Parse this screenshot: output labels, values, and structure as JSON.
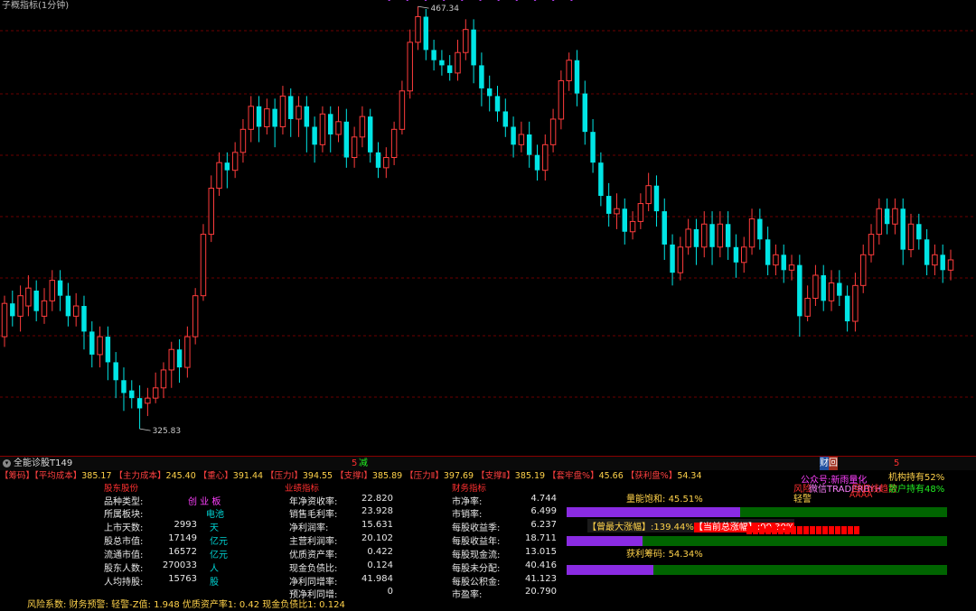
{
  "chart_data": {
    "type": "candlestick",
    "title": "子概指标(1分钟)",
    "ylim": [
      300,
      480
    ],
    "annotations": {
      "high": "467.34",
      "low": "325.83"
    },
    "gridlines": [
      475,
      445,
      415,
      385,
      355,
      325,
      300
    ],
    "colors": {
      "up": "#ff3c3c",
      "down": "#00e5e5",
      "grid": "#6b0000"
    },
    "candles": [
      [
        1,
        362,
        375,
        358,
        378
      ],
      [
        2,
        375,
        370,
        366,
        380
      ],
      [
        3,
        370,
        378,
        364,
        382
      ],
      [
        4,
        374,
        381,
        370,
        386
      ],
      [
        5,
        380,
        372,
        368,
        384
      ],
      [
        6,
        370,
        376,
        367,
        381
      ],
      [
        7,
        376,
        384,
        372,
        388
      ],
      [
        8,
        384,
        378,
        372,
        388
      ],
      [
        9,
        378,
        370,
        366,
        383
      ],
      [
        10,
        370,
        374,
        366,
        379
      ],
      [
        11,
        374,
        364,
        357,
        378
      ],
      [
        12,
        364,
        355,
        350,
        368
      ],
      [
        13,
        355,
        362,
        350,
        366
      ],
      [
        14,
        362,
        352,
        345,
        366
      ],
      [
        15,
        352,
        345,
        338,
        356
      ],
      [
        16,
        345,
        340,
        333,
        350
      ],
      [
        17,
        341,
        338,
        334,
        345
      ],
      [
        18,
        338,
        334,
        326,
        343
      ],
      [
        19,
        336,
        338,
        331,
        342
      ],
      [
        20,
        338,
        342,
        336,
        348
      ],
      [
        21,
        342,
        349,
        338,
        352
      ],
      [
        22,
        349,
        357,
        342,
        360
      ],
      [
        23,
        357,
        350,
        344,
        361
      ],
      [
        24,
        350,
        362,
        346,
        366
      ],
      [
        25,
        362,
        378,
        359,
        381
      ],
      [
        26,
        378,
        402,
        376,
        406
      ],
      [
        27,
        402,
        420,
        399,
        425
      ],
      [
        28,
        420,
        430,
        417,
        434
      ],
      [
        29,
        430,
        427,
        420,
        434
      ],
      [
        30,
        427,
        434,
        424,
        438
      ],
      [
        31,
        434,
        443,
        430,
        447
      ],
      [
        32,
        443,
        452,
        438,
        456
      ],
      [
        33,
        452,
        444,
        438,
        456
      ],
      [
        34,
        444,
        451,
        441,
        455
      ],
      [
        35,
        451,
        444,
        436,
        455
      ],
      [
        36,
        444,
        456,
        441,
        460
      ],
      [
        37,
        456,
        447,
        440,
        459
      ],
      [
        38,
        447,
        452,
        440,
        456
      ],
      [
        39,
        452,
        444,
        434,
        456
      ],
      [
        40,
        444,
        437,
        430,
        448
      ],
      [
        41,
        437,
        449,
        434,
        452
      ],
      [
        42,
        449,
        441,
        434,
        452
      ],
      [
        43,
        441,
        446,
        438,
        452
      ],
      [
        44,
        446,
        432,
        428,
        451
      ],
      [
        45,
        432,
        440,
        428,
        444
      ],
      [
        46,
        440,
        448,
        436,
        452
      ],
      [
        47,
        448,
        434,
        430,
        451
      ],
      [
        48,
        434,
        428,
        424,
        438
      ],
      [
        49,
        428,
        432,
        424,
        436
      ],
      [
        50,
        432,
        443,
        429,
        446
      ],
      [
        51,
        443,
        458,
        441,
        462
      ],
      [
        52,
        458,
        477,
        455,
        482
      ],
      [
        53,
        477,
        487,
        474,
        491
      ],
      [
        54,
        487,
        474,
        470,
        490
      ],
      [
        55,
        474,
        470,
        466,
        478
      ],
      [
        56,
        470,
        468,
        464,
        474
      ],
      [
        57,
        468,
        465,
        462,
        472
      ],
      [
        58,
        465,
        473,
        462,
        478
      ],
      [
        59,
        473,
        482,
        470,
        486
      ],
      [
        60,
        482,
        468,
        461,
        486
      ],
      [
        61,
        468,
        459,
        452,
        473
      ],
      [
        62,
        459,
        456,
        450,
        464
      ],
      [
        63,
        456,
        450,
        446,
        460
      ],
      [
        64,
        450,
        444,
        440,
        455
      ],
      [
        65,
        444,
        437,
        432,
        448
      ],
      [
        66,
        437,
        441,
        434,
        446
      ],
      [
        67,
        441,
        433,
        428,
        446
      ],
      [
        68,
        433,
        427,
        423,
        437
      ],
      [
        69,
        427,
        437,
        423,
        441
      ],
      [
        70,
        437,
        447,
        434,
        451
      ],
      [
        71,
        447,
        462,
        443,
        466
      ],
      [
        72,
        462,
        470,
        458,
        473
      ],
      [
        73,
        470,
        457,
        452,
        474
      ],
      [
        74,
        457,
        442,
        437,
        462
      ],
      [
        75,
        442,
        430,
        426,
        447
      ],
      [
        76,
        430,
        417,
        413,
        434
      ],
      [
        77,
        417,
        410,
        405,
        422
      ],
      [
        78,
        410,
        412,
        404,
        418
      ],
      [
        79,
        412,
        403,
        398,
        416
      ],
      [
        80,
        403,
        407,
        400,
        411
      ],
      [
        81,
        407,
        414,
        404,
        418
      ],
      [
        82,
        414,
        421,
        411,
        426
      ],
      [
        83,
        421,
        411,
        405,
        425
      ],
      [
        84,
        411,
        398,
        392,
        416
      ],
      [
        85,
        398,
        387,
        382,
        402
      ],
      [
        86,
        387,
        397,
        384,
        401
      ],
      [
        87,
        397,
        404,
        394,
        408
      ],
      [
        88,
        404,
        397,
        390,
        408
      ],
      [
        89,
        397,
        406,
        393,
        411
      ],
      [
        90,
        406,
        397,
        390,
        411
      ],
      [
        91,
        397,
        406,
        393,
        411
      ],
      [
        92,
        406,
        397,
        392,
        411
      ],
      [
        93,
        397,
        391,
        385,
        402
      ],
      [
        94,
        391,
        397,
        387,
        401
      ],
      [
        95,
        397,
        408,
        394,
        412
      ],
      [
        96,
        408,
        400,
        396,
        412
      ],
      [
        97,
        400,
        390,
        386,
        405
      ],
      [
        98,
        390,
        394,
        386,
        398
      ],
      [
        99,
        394,
        388,
        383,
        398
      ],
      [
        100,
        388,
        390,
        384,
        394
      ],
      [
        101,
        390,
        370,
        362,
        394
      ],
      [
        102,
        370,
        377,
        368,
        382
      ],
      [
        103,
        377,
        386,
        374,
        390
      ],
      [
        104,
        386,
        376,
        372,
        390
      ],
      [
        105,
        376,
        383,
        372,
        388
      ],
      [
        106,
        383,
        378,
        374,
        388
      ],
      [
        107,
        378,
        368,
        364,
        382
      ],
      [
        108,
        368,
        382,
        364,
        387
      ],
      [
        109,
        382,
        394,
        379,
        398
      ],
      [
        110,
        394,
        402,
        391,
        406
      ],
      [
        111,
        402,
        412,
        398,
        416
      ],
      [
        112,
        412,
        406,
        402,
        416
      ],
      [
        113,
        406,
        412,
        402,
        416
      ],
      [
        114,
        412,
        396,
        390,
        416
      ],
      [
        115,
        396,
        406,
        393,
        410
      ],
      [
        116,
        406,
        400,
        396,
        410
      ],
      [
        117,
        400,
        390,
        386,
        404
      ],
      [
        118,
        390,
        394,
        386,
        398
      ],
      [
        119,
        394,
        388,
        383,
        398
      ],
      [
        120,
        388,
        392,
        384,
        396
      ]
    ]
  },
  "chart_title_text": "子概指标(1分钟)",
  "top_markers": "• • • • • • • • • • •",
  "high_label": "467.34",
  "low_label": "325.83",
  "panel": {
    "name": "全能诊股T149",
    "mark_jian": "减",
    "mark_num": "5",
    "mark_cai": "财",
    "mark_hui": "回",
    "mark_5b": "5"
  },
  "indicators": [
    {
      "k": "【筹码】【平均成本】",
      "v": "385.17"
    },
    {
      "k": "【主力成本】",
      "v": "245.40"
    },
    {
      "k": "【重心】",
      "v": "391.44"
    },
    {
      "k": "【压力Ⅰ】",
      "v": "394.55"
    },
    {
      "k": "【支撑Ⅰ】",
      "v": "385.89"
    },
    {
      "k": "【压力Ⅱ】",
      "v": "397.69"
    },
    {
      "k": "【支撑Ⅱ】",
      "v": "385.19"
    },
    {
      "k": "【套牢盘%】",
      "v": "45.66"
    },
    {
      "k": "【获利盘%】",
      "v": "54.34"
    }
  ],
  "sections": {
    "s1": "股东股份",
    "s2": "业绩指标",
    "s3": "财务指标"
  },
  "left": [
    {
      "label": "品种类型:",
      "value": "创 业 板",
      "unit": ""
    },
    {
      "label": "所属板块:",
      "value": "电池",
      "unit": ""
    },
    {
      "label": "上市天数:",
      "value": "2993",
      "unit": "天"
    },
    {
      "label": "股总市值:",
      "value": "17149",
      "unit": "亿元"
    },
    {
      "label": "流通市值:",
      "value": "16572",
      "unit": "亿元"
    },
    {
      "label": "股东人数:",
      "value": "270033",
      "unit": "人"
    },
    {
      "label": "人均持股:",
      "value": "15763",
      "unit": "股"
    }
  ],
  "mid": [
    {
      "label": "年净资收率:",
      "value": "22.820"
    },
    {
      "label": "销售毛利率:",
      "value": "23.928"
    },
    {
      "label": "净利润率:",
      "value": "15.631"
    },
    {
      "label": "主营利润率:",
      "value": "20.102"
    },
    {
      "label": "优质资产率:",
      "value": "0.422"
    },
    {
      "label": "现金负债比:",
      "value": "0.124"
    },
    {
      "label": "净利同增率:",
      "value": "41.984"
    },
    {
      "label": "预净利同增:",
      "value": "0"
    }
  ],
  "fin": [
    {
      "label": "市净率:",
      "value": "4.744"
    },
    {
      "label": "市销率:",
      "value": "6.499"
    },
    {
      "label": "每股收益季:",
      "value": "6.237"
    },
    {
      "label": "每股收益年:",
      "value": "18.711"
    },
    {
      "label": "每股现金流:",
      "value": "13.015"
    },
    {
      "label": "每股未分配:",
      "value": "40.416"
    },
    {
      "label": "每股公积金:",
      "value": "41.123"
    },
    {
      "label": "市盈率:",
      "value": "20.790"
    }
  ],
  "right": {
    "gzh": "公众号:新雨量化",
    "wx": "微信TRADERBYH",
    "inst": "机构持有52%",
    "retail": "散户持有48%",
    "fengxian": "风险",
    "qingjing": "轻警",
    "mark_mid": "回归线趋势",
    "marks_a": "AAAA",
    "qb_label": "量能饱和:",
    "qb_value": "45.51%",
    "qb_fill": 0.4551,
    "max_label": "【曾最大涨幅】:",
    "max_value": "139.44%",
    "cur_label": "【当前总涨幅】:",
    "cur_value": "99.30%",
    "cur_fill": 0.5,
    "gl_label": "获利筹码:",
    "gl_value": "54.34%",
    "gl_fill": 0.5434,
    "third_fill": 0.5435
  },
  "footer": {
    "text1": "风险系数: 财务预警: 轻警-Z值: 1.948 优质资产率1: 0.42 现金负债比1: 0.124"
  }
}
